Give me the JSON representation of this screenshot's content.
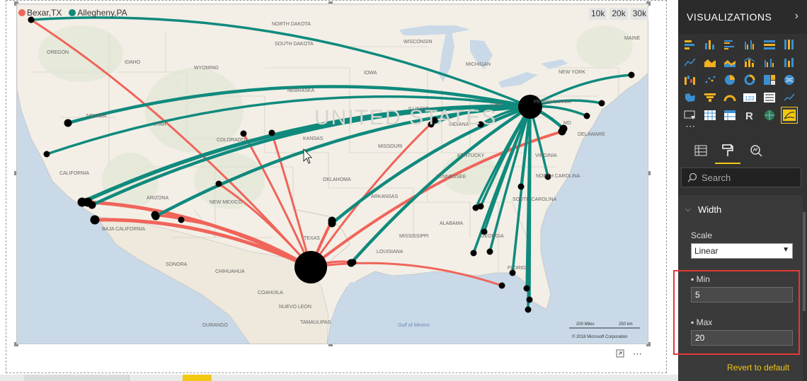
{
  "legend": [
    {
      "label": "Bexar,TX",
      "color": "#f0645a"
    },
    {
      "label": "Allegheny,PA",
      "color": "#0f8a7d"
    }
  ],
  "scale_buttons": [
    "10k",
    "20k",
    "30k"
  ],
  "map_labels": {
    "states": [
      "OREGON",
      "IDAHO",
      "WYOMING",
      "NEVADA",
      "UTAH",
      "COLORADO",
      "CALIFORNIA",
      "ARIZONA",
      "NEW MEXICO",
      "KANSAS",
      "NEBRASKA",
      "OKLAHOMA",
      "TEXAS",
      "MISSOURI",
      "IOWA",
      "ILLINOIS",
      "INDIANA",
      "OHIO",
      "KENTUCKY",
      "TENNESSEE",
      "ARKANSAS",
      "MISSISSIPPI",
      "LOUISIANA",
      "ALABAMA",
      "GEORGIA",
      "FLORIDA",
      "SOUTH CAROLINA",
      "NORTH CAROLINA",
      "VIRGINIA",
      "PENNSYLVANIA",
      "NEW YORK",
      "MICHIGAN",
      "WISCONSIN",
      "SOUTH DAKOTA",
      "NORTH DAKOTA",
      "MAINE",
      "DELAWARE",
      "MD",
      "BAJA CALIFORNIA",
      "SONORA",
      "CHIHUAHUA",
      "COAHUILA",
      "NUEVO LEON",
      "TAMAULIPAS",
      "DURANGO"
    ],
    "country": "UNITED STATES",
    "water": "Gulf of Mexico",
    "scale_miles": "200 Miles",
    "scale_km": "250 km",
    "copyright": "© 2018 Microsoft Corporation"
  },
  "pane": {
    "title": "VISUALIZATIONS",
    "search_placeholder": "Search",
    "section_title": "Width",
    "scale_label": "Scale",
    "scale_value": "Linear",
    "min_label": "Min",
    "min_value": "5",
    "max_label": "Max",
    "max_value": "20",
    "revert_label": "Revert to default"
  },
  "colors": {
    "bexar": "#f0645a",
    "allegheny": "#0f8a7d",
    "accent": "#f2c811",
    "highlight": "#e53935"
  }
}
